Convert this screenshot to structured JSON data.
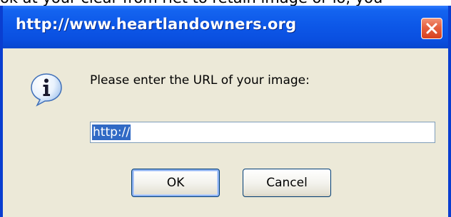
{
  "background": {
    "partial_text": "ok at your clear from rlet to retain image or lo, you"
  },
  "dialog": {
    "title": "http://www.heartlandowners.org",
    "message": "Please enter the URL of your image:",
    "url_input": {
      "value": "http://",
      "selected": true
    },
    "ok_label": "OK",
    "cancel_label": "Cancel",
    "icons": {
      "info": "info-icon",
      "close": "close-icon"
    }
  },
  "colors": {
    "titlebar": "#0a4fe0",
    "client": "#ece9d8",
    "close_button": "#e5603f",
    "selection": "#316ac5"
  }
}
